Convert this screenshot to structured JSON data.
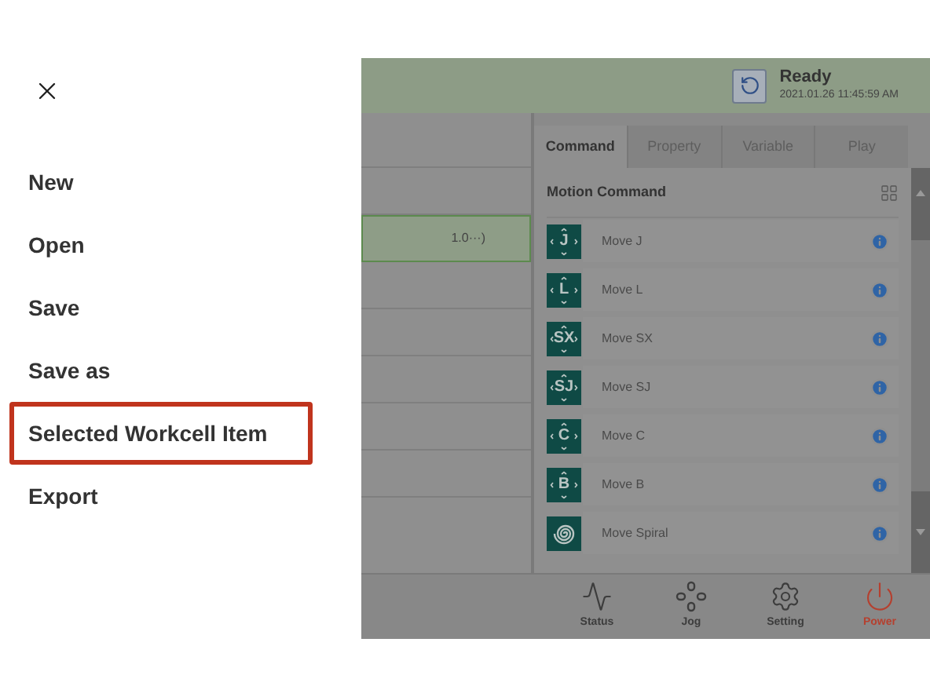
{
  "menu": {
    "items": [
      {
        "label": "New",
        "selected": false
      },
      {
        "label": "Open",
        "selected": false
      },
      {
        "label": "Save",
        "selected": false
      },
      {
        "label": "Save as",
        "selected": false
      },
      {
        "label": "Selected Workcell Item",
        "selected": true
      },
      {
        "label": "Export",
        "selected": false
      }
    ]
  },
  "app": {
    "status": {
      "label": "Ready",
      "time": "2021.01.26 11:45:59 AM"
    },
    "program": {
      "rows": [
        {
          "text": "",
          "selected": false
        },
        {
          "text": "",
          "selected": false
        },
        {
          "text": "1.0···)",
          "selected": true
        }
      ]
    },
    "tabs": [
      {
        "label": "Command",
        "selected": true
      },
      {
        "label": "Property",
        "selected": false
      },
      {
        "label": "Variable",
        "selected": false
      },
      {
        "label": "Play",
        "selected": false
      }
    ],
    "section_title": "Motion Command",
    "commands": [
      {
        "kind": "letter",
        "glyph": "J",
        "label": "Move J"
      },
      {
        "kind": "letter",
        "glyph": "L",
        "label": "Move L"
      },
      {
        "kind": "letter",
        "glyph": "SX",
        "label": "Move SX"
      },
      {
        "kind": "letter",
        "glyph": "SJ",
        "label": "Move SJ"
      },
      {
        "kind": "letter",
        "glyph": "C",
        "label": "Move C"
      },
      {
        "kind": "letter",
        "glyph": "B",
        "label": "Move B"
      },
      {
        "kind": "spiral",
        "label": "Move Spiral"
      }
    ],
    "nav": [
      {
        "kind": "status",
        "label": "Status",
        "color": "#3d3d3d"
      },
      {
        "kind": "jog",
        "label": "Jog",
        "color": "#3d3d3d"
      },
      {
        "kind": "setting",
        "label": "Setting",
        "color": "#3d3d3d"
      },
      {
        "kind": "power",
        "label": "Power",
        "color": "#b5402f"
      }
    ]
  }
}
